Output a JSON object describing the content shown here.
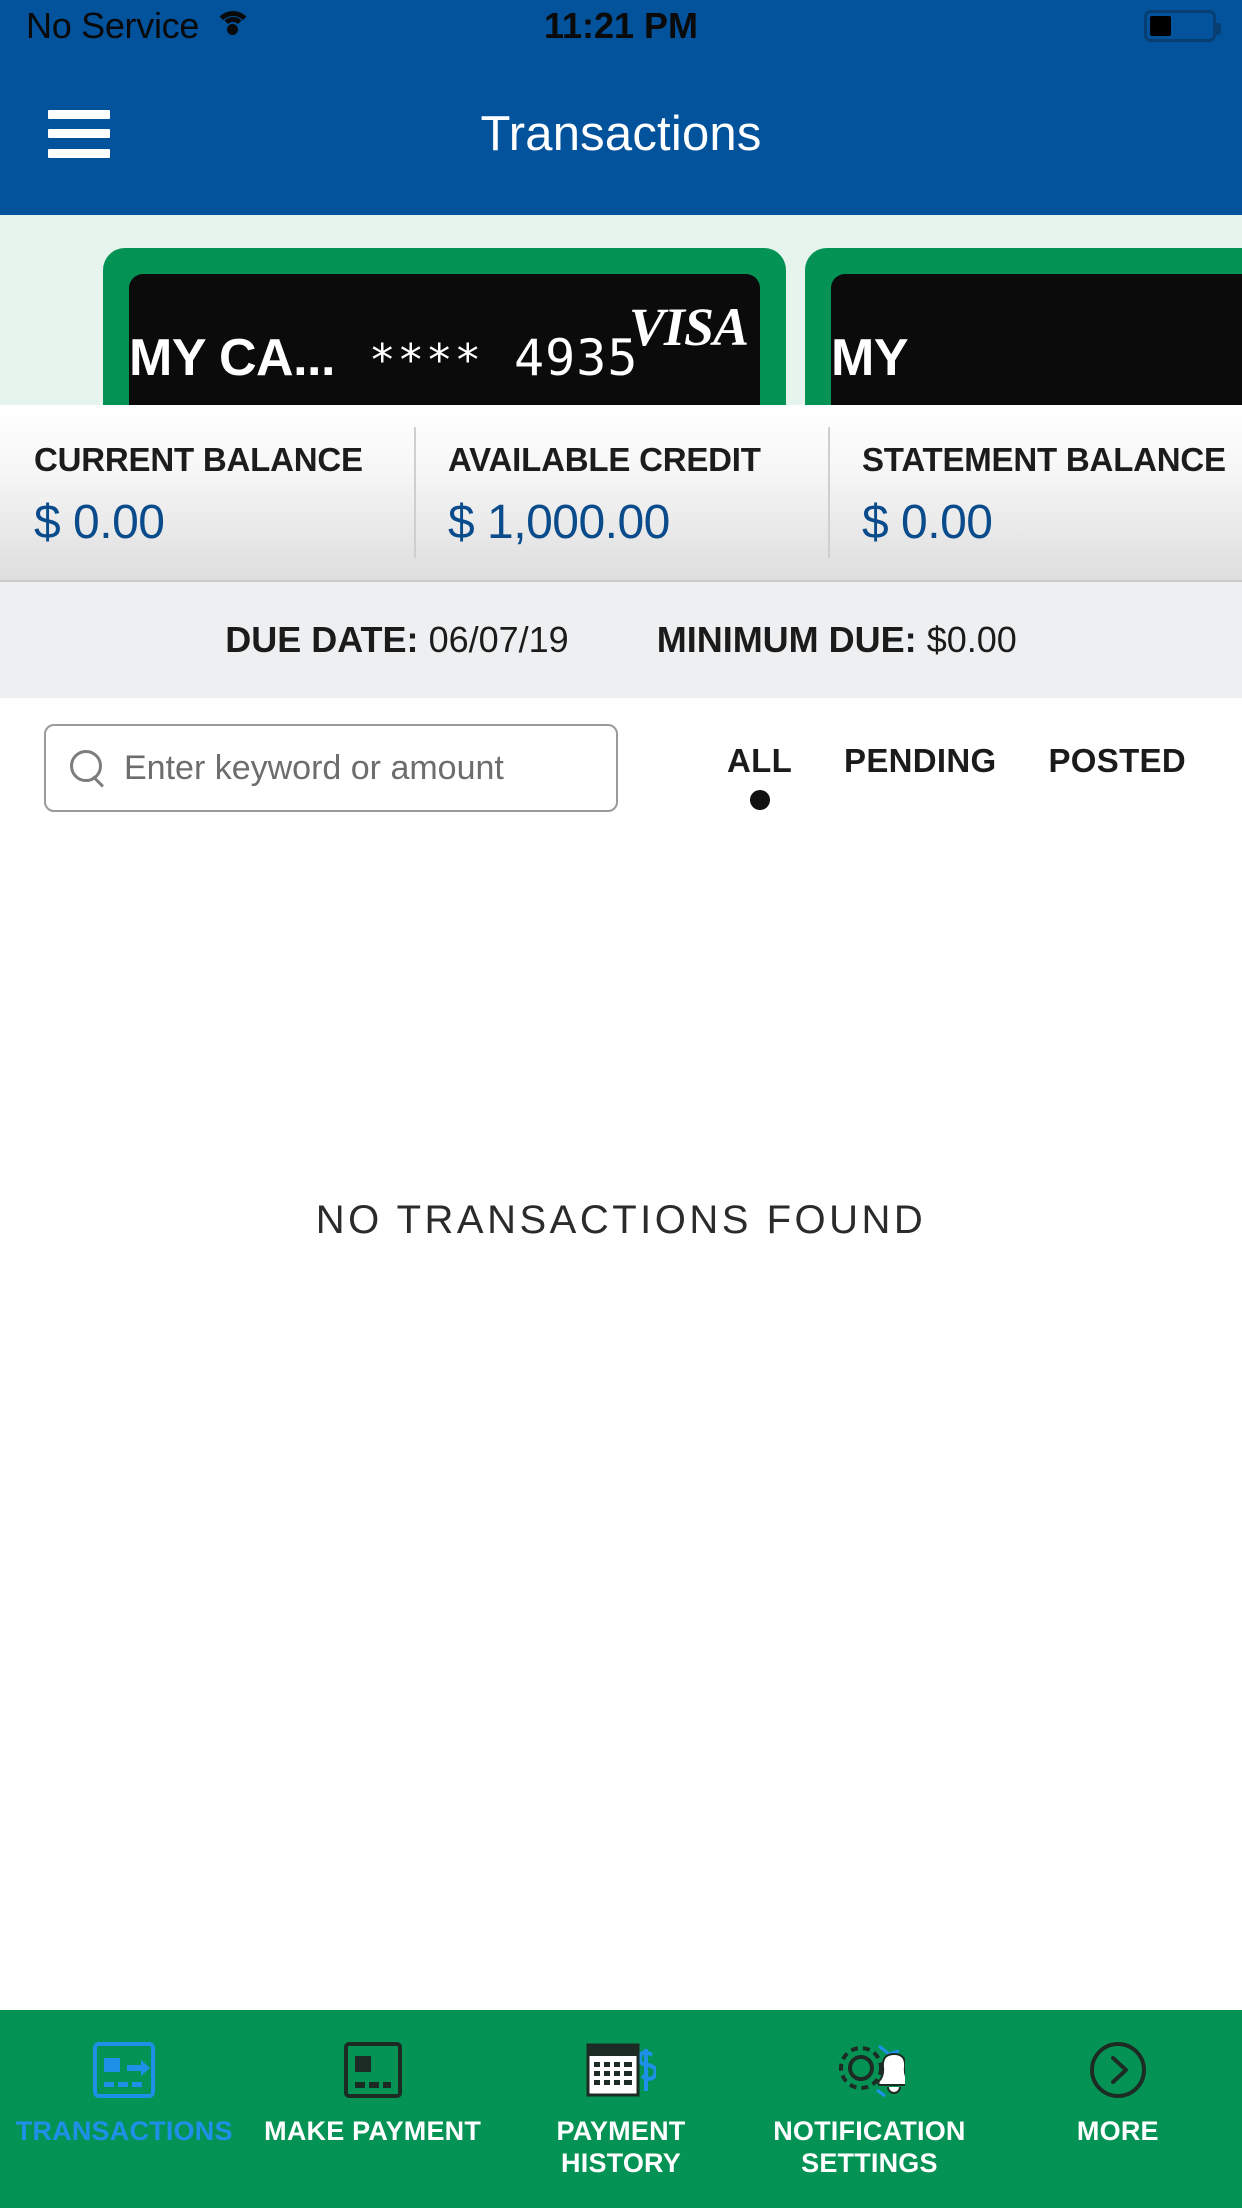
{
  "statusbar": {
    "carrier": "No Service",
    "time": "11:21 PM",
    "wifi_icon": "wifi-icon",
    "battery_icon": "battery-icon"
  },
  "header": {
    "title": "Transactions",
    "menu_icon": "hamburger-menu-icon"
  },
  "cards": [
    {
      "name": "MY CA...",
      "mask": "****",
      "last4": "4935",
      "brand": "VISA"
    },
    {
      "name": "MY",
      "mask": "",
      "last4": "",
      "brand": ""
    }
  ],
  "balances": [
    {
      "label": "CURRENT BALANCE",
      "value": "$ 0.00"
    },
    {
      "label": "AVAILABLE CREDIT",
      "value": "$ 1,000.00"
    },
    {
      "label": "STATEMENT BALANCE",
      "value": "$ 0.00"
    }
  ],
  "due": {
    "due_date_label": "DUE DATE:",
    "due_date_value": "06/07/19",
    "minimum_label": "MINIMUM DUE:",
    "minimum_value": "$0.00"
  },
  "search": {
    "placeholder": "Enter keyword or amount",
    "value": "",
    "icon": "search-icon"
  },
  "filters": [
    {
      "label": "ALL",
      "active": true
    },
    {
      "label": "PENDING",
      "active": false
    },
    {
      "label": "POSTED",
      "active": false
    }
  ],
  "empty_state": {
    "message": "NO TRANSACTIONS FOUND"
  },
  "tabbar": [
    {
      "label": "TRANSACTIONS",
      "icon": "card-transfer-icon",
      "active": true
    },
    {
      "label": "MAKE PAYMENT",
      "icon": "credit-card-icon",
      "active": false
    },
    {
      "label": "PAYMENT HISTORY",
      "icon": "calendar-dollar-icon",
      "active": false
    },
    {
      "label": "NOTIFICATION SETTINGS",
      "icon": "gear-bell-icon",
      "active": false
    },
    {
      "label": "MORE",
      "icon": "chevron-right-circle-icon",
      "active": false
    }
  ],
  "colors": {
    "header_blue": "#02529c",
    "brand_green": "#059355",
    "accent_blue": "#1f90e8",
    "value_blue": "#0a4b8c",
    "carousel_bg": "#e7f4ee"
  }
}
